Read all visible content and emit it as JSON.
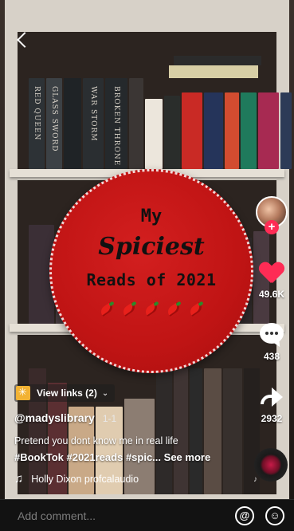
{
  "video": {
    "overlay_line1": "My",
    "overlay_line2": "Spiciest",
    "overlay_line3": "Reads of 2021",
    "overlay_pepper_count": 5,
    "spines_top": [
      "RED QUEEN",
      "GLASS SWORD",
      "WAR STORM",
      "BROKEN THRONE"
    ]
  },
  "nav": {
    "back_icon": "chevron-left-icon"
  },
  "rail": {
    "likes": "49.6K",
    "comments": "438",
    "shares": "2932",
    "accent": "#fe2c55"
  },
  "caption": {
    "links_label": "View links (2)",
    "username": "@madyslibrary",
    "page_indicator": "1-1",
    "description": "Pretend you dont know me in real life",
    "hashtags": "#BookTok #2021reads #spic...",
    "see_more": "See more",
    "sound": "Holly Dixon profcalaudio"
  },
  "comment_bar": {
    "placeholder": "Add comment...",
    "mention_icon": "at-icon",
    "emoji_icon": "emoji-icon"
  }
}
